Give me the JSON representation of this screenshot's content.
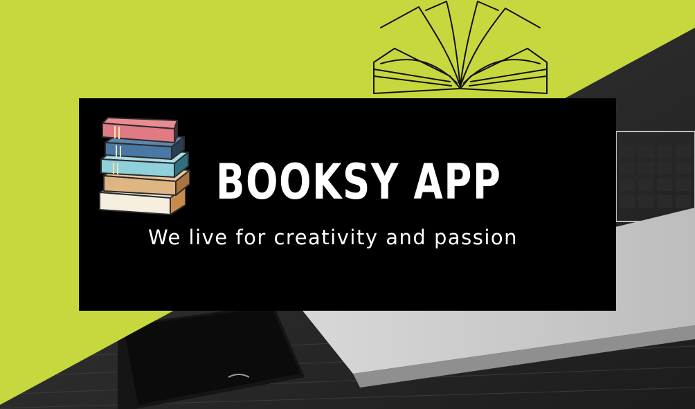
{
  "app": {
    "title": "BOOKSY APP",
    "tagline": "We live for creativity and passion"
  },
  "colors": {
    "accent_lime": "#c6d83e",
    "banner_black": "#000000",
    "text_white": "#ffffff"
  },
  "icons": {
    "hero_illustration": "open-book-icon",
    "logo": "book-stack-icon"
  }
}
